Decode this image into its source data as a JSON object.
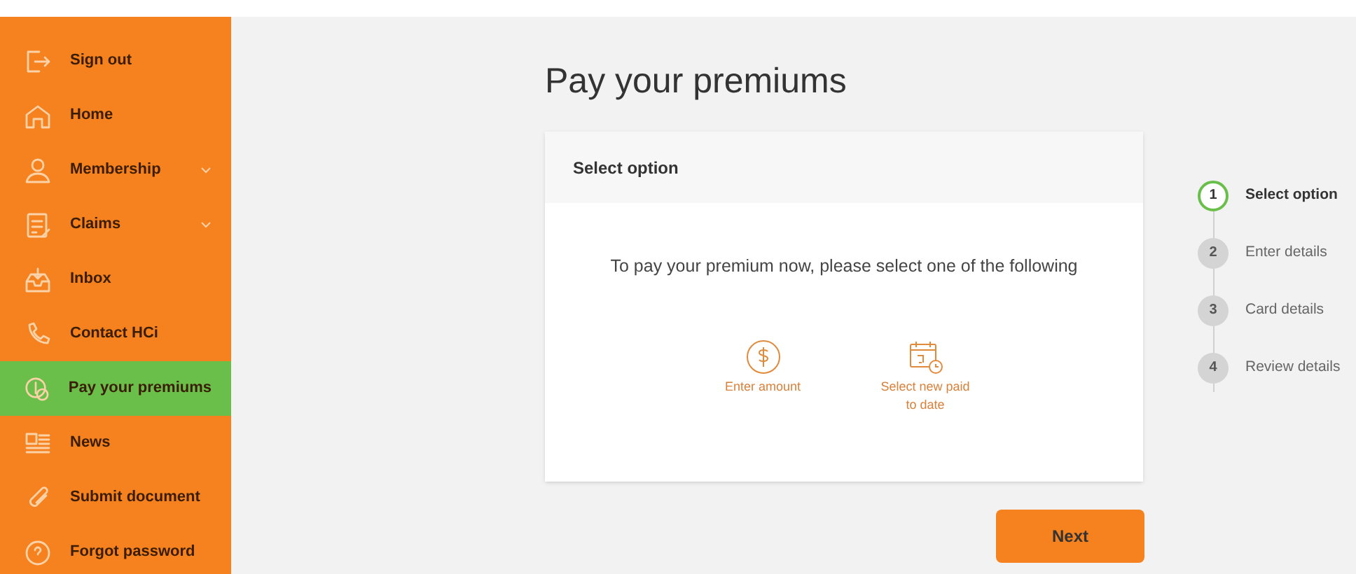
{
  "sidebar": {
    "items": [
      {
        "label": "Sign out",
        "selected": false,
        "expandable": false
      },
      {
        "label": "Home",
        "selected": false,
        "expandable": false
      },
      {
        "label": "Membership",
        "selected": false,
        "expandable": true
      },
      {
        "label": "Claims",
        "selected": false,
        "expandable": true
      },
      {
        "label": "Inbox",
        "selected": false,
        "expandable": false
      },
      {
        "label": "Contact HCi",
        "selected": false,
        "expandable": false
      },
      {
        "label": "Pay your premiums",
        "selected": true,
        "expandable": false
      },
      {
        "label": "News",
        "selected": false,
        "expandable": false
      },
      {
        "label": "Submit document",
        "selected": false,
        "expandable": false
      },
      {
        "label": "Forgot password",
        "selected": false,
        "expandable": false
      }
    ]
  },
  "page_title": "Pay your premiums",
  "card": {
    "header": "Select option",
    "instruction": "To pay your premium now, please select one of the following",
    "options": [
      {
        "kind": "amount",
        "label": "Enter amount"
      },
      {
        "kind": "date",
        "label": "Select new paid to date"
      }
    ]
  },
  "steps": [
    {
      "number": "1",
      "label": "Select option",
      "selected": true
    },
    {
      "number": "2",
      "label": "Enter details",
      "selected": false
    },
    {
      "number": "3",
      "label": "Card details",
      "selected": false
    },
    {
      "number": "4",
      "label": "Review details",
      "selected": false
    }
  ],
  "next_button": "Next"
}
